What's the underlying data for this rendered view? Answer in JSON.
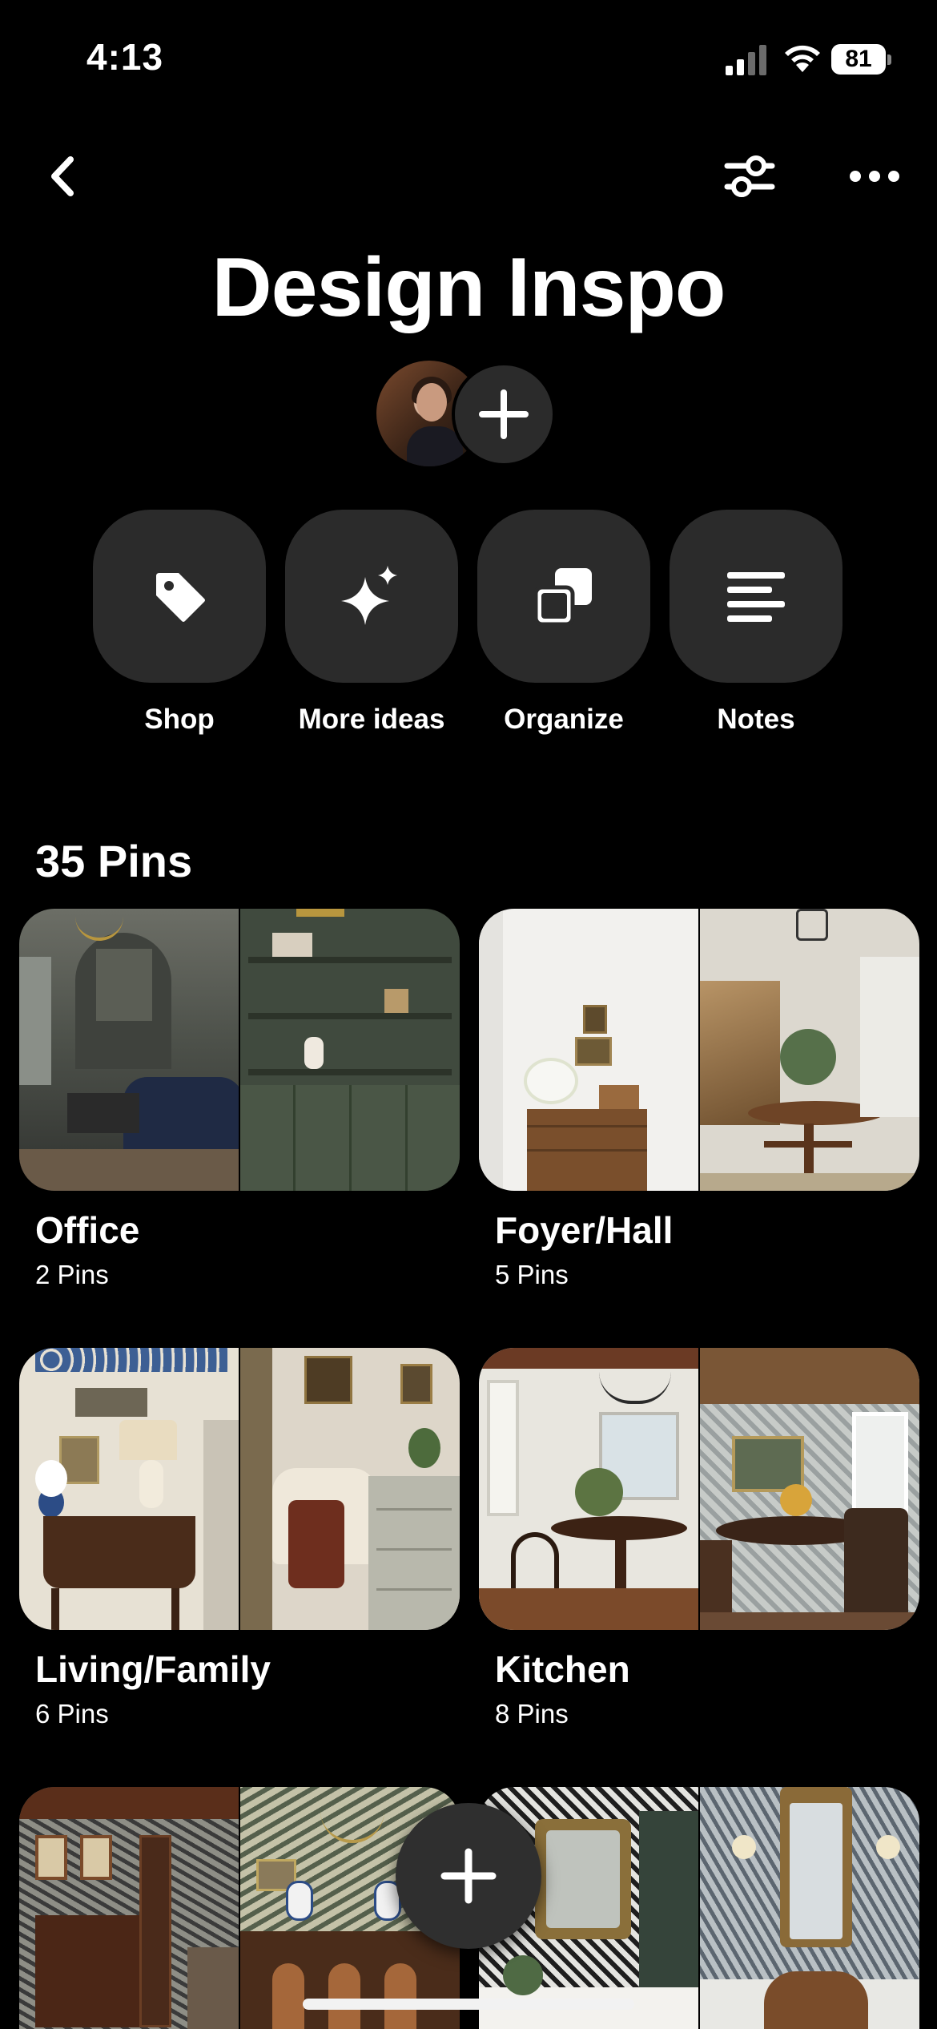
{
  "status_bar": {
    "time": "4:13",
    "battery": "81"
  },
  "board": {
    "title": "Design Inspo"
  },
  "actions": [
    {
      "label": "Shop",
      "icon": "tag-icon"
    },
    {
      "label": "More ideas",
      "icon": "sparkle-icon"
    },
    {
      "label": "Organize",
      "icon": "organize-icon"
    },
    {
      "label": "Notes",
      "icon": "notes-icon"
    }
  ],
  "pins": {
    "count_label": "35 Pins"
  },
  "sections": [
    {
      "name": "Office",
      "count": "2 Pins"
    },
    {
      "name": "Foyer/Hall",
      "count": "5 Pins"
    },
    {
      "name": "Living/Family",
      "count": "6 Pins"
    },
    {
      "name": "Kitchen",
      "count": "8 Pins"
    }
  ],
  "colors": {
    "background": "#000000",
    "tile": "#2b2b2b",
    "text": "#ffffff"
  },
  "icons": {
    "back": "chevron-left-icon",
    "filter": "sliders-icon",
    "more": "more-horizontal-icon",
    "add": "plus-icon"
  }
}
